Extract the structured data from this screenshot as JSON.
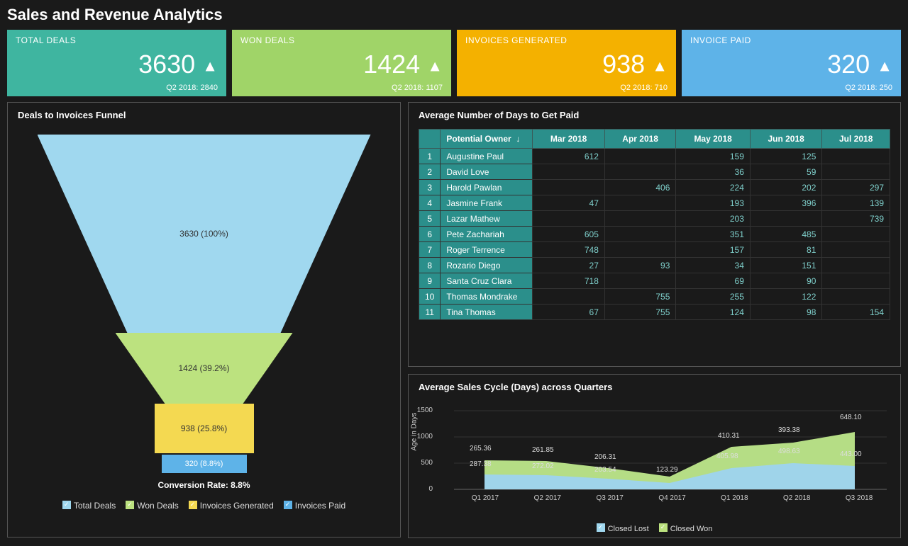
{
  "title": "Sales and Revenue Analytics",
  "kpi": [
    {
      "label": "TOTAL DEALS",
      "value": "3630",
      "sub": "Q2 2018: 2840"
    },
    {
      "label": "WON DEALS",
      "value": "1424",
      "sub": "Q2 2018: 1107"
    },
    {
      "label": "INVOICES GENERATED",
      "value": "938",
      "sub": "Q2 2018: 710"
    },
    {
      "label": "INVOICE PAID",
      "value": "320",
      "sub": "Q2 2018: 250"
    }
  ],
  "funnel": {
    "title": "Deals to Invoices Funnel",
    "seg": [
      "3630 (100%)",
      "1424 (39.2%)",
      "938 (25.8%)",
      "320 (8.8%)"
    ],
    "conv": "Conversion Rate: 8.8%",
    "legend": [
      "Total Deals",
      "Won Deals",
      "Invoices Generated",
      "Invoices Paid"
    ]
  },
  "table": {
    "title": "Average Number of Days to Get Paid",
    "headers": [
      "Potential Owner",
      "Mar 2018",
      "Apr 2018",
      "May 2018",
      "Jun 2018",
      "Jul 2018"
    ],
    "rows": [
      {
        "n": "1",
        "owner": "Augustine Paul",
        "cells": [
          "612",
          "",
          "159",
          "125",
          ""
        ]
      },
      {
        "n": "2",
        "owner": "David Love",
        "cells": [
          "",
          "",
          "36",
          "59",
          ""
        ]
      },
      {
        "n": "3",
        "owner": "Harold Pawlan",
        "cells": [
          "",
          "406",
          "224",
          "202",
          "297"
        ]
      },
      {
        "n": "4",
        "owner": "Jasmine Frank",
        "cells": [
          "47",
          "",
          "193",
          "396",
          "139"
        ]
      },
      {
        "n": "5",
        "owner": "Lazar Mathew",
        "cells": [
          "",
          "",
          "203",
          "",
          "739"
        ]
      },
      {
        "n": "6",
        "owner": "Pete Zachariah",
        "cells": [
          "605",
          "",
          "351",
          "485",
          ""
        ]
      },
      {
        "n": "7",
        "owner": "Roger Terrence",
        "cells": [
          "748",
          "",
          "157",
          "81",
          ""
        ]
      },
      {
        "n": "8",
        "owner": "Rozario Diego",
        "cells": [
          "27",
          "93",
          "34",
          "151",
          ""
        ]
      },
      {
        "n": "9",
        "owner": "Santa Cruz Clara",
        "cells": [
          "718",
          "",
          "69",
          "90",
          ""
        ]
      },
      {
        "n": "10",
        "owner": "Thomas Mondrake",
        "cells": [
          "",
          "755",
          "255",
          "122",
          ""
        ]
      },
      {
        "n": "11",
        "owner": "Tina Thomas",
        "cells": [
          "67",
          "755",
          "124",
          "98",
          "154"
        ]
      }
    ]
  },
  "chart": {
    "title": "Average Sales Cycle (Days) across Quarters",
    "ylabel": "Age in Days",
    "yticks": [
      "0",
      "500",
      "1000",
      "1500"
    ],
    "x": [
      "Q1 2017",
      "Q2 2017",
      "Q3 2017",
      "Q4 2017",
      "Q1 2018",
      "Q2 2018",
      "Q3 2018"
    ],
    "legend": [
      "Closed Lost",
      "Closed Won"
    ],
    "labels": {
      "won": [
        "265.36",
        "261.85",
        "206.31",
        "123.29",
        "410.31",
        "393.38",
        "648.10"
      ],
      "lost": [
        "287.38",
        "272.02",
        "203.54",
        "",
        "405.98",
        "498.63",
        "443.00"
      ]
    }
  },
  "chart_data": [
    {
      "type": "funnel",
      "title": "Deals to Invoices Funnel",
      "stages": [
        {
          "name": "Total Deals",
          "value": 3630,
          "pct": 100.0
        },
        {
          "name": "Won Deals",
          "value": 1424,
          "pct": 39.2
        },
        {
          "name": "Invoices Generated",
          "value": 938,
          "pct": 25.8
        },
        {
          "name": "Invoices Paid",
          "value": 320,
          "pct": 8.8
        }
      ],
      "conversion_rate": 8.8
    },
    {
      "type": "table",
      "title": "Average Number of Days to Get Paid",
      "columns": [
        "Potential Owner",
        "Mar 2018",
        "Apr 2018",
        "May 2018",
        "Jun 2018",
        "Jul 2018"
      ],
      "rows": [
        [
          "Augustine Paul",
          612,
          null,
          159,
          125,
          null
        ],
        [
          "David Love",
          null,
          null,
          36,
          59,
          null
        ],
        [
          "Harold Pawlan",
          null,
          406,
          224,
          202,
          297
        ],
        [
          "Jasmine Frank",
          47,
          null,
          193,
          396,
          139
        ],
        [
          "Lazar Mathew",
          null,
          null,
          203,
          null,
          739
        ],
        [
          "Pete Zachariah",
          605,
          null,
          351,
          485,
          null
        ],
        [
          "Roger Terrence",
          748,
          null,
          157,
          81,
          null
        ],
        [
          "Rozario Diego",
          27,
          93,
          34,
          151,
          null
        ],
        [
          "Santa Cruz Clara",
          718,
          null,
          69,
          90,
          null
        ],
        [
          "Thomas Mondrake",
          null,
          755,
          255,
          122,
          null
        ],
        [
          "Tina Thomas",
          67,
          755,
          124,
          98,
          154
        ]
      ]
    },
    {
      "type": "area",
      "title": "Average Sales Cycle (Days) across Quarters",
      "xlabel": "",
      "ylabel": "Age in Days",
      "ylim": [
        0,
        1500
      ],
      "categories": [
        "Q1 2017",
        "Q2 2017",
        "Q3 2017",
        "Q4 2017",
        "Q1 2018",
        "Q2 2018",
        "Q3 2018"
      ],
      "series": [
        {
          "name": "Closed Lost",
          "values": [
            287.38,
            272.02,
            203.54,
            123.29,
            405.98,
            498.63,
            443.0
          ]
        },
        {
          "name": "Closed Won",
          "values": [
            265.36,
            261.85,
            206.31,
            123.29,
            410.31,
            393.38,
            648.1
          ]
        }
      ],
      "stacked": true
    }
  ]
}
